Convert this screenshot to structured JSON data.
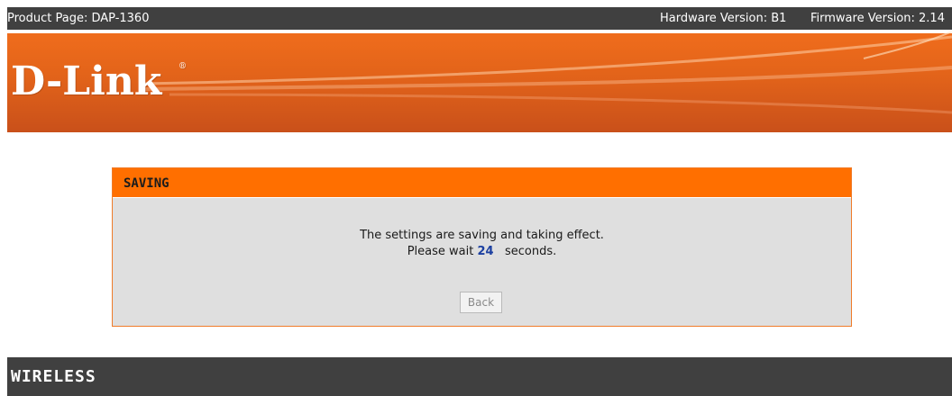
{
  "topbar": {
    "product": "Product Page: DAP-1360",
    "hardware": "Hardware Version: B1",
    "firmware": "Firmware Version: 2.14"
  },
  "brand": {
    "logo_text": "D-Link",
    "registered_mark": "®",
    "banner_color": "#e2631a"
  },
  "saving": {
    "title": "SAVING",
    "line1": "The settings are saving and taking effect.",
    "wait_prefix": "Please wait",
    "seconds_value": "24",
    "wait_suffix": "seconds.",
    "back_label": "Back",
    "header_color": "#ff6f00",
    "count_color": "#1b3fa0"
  },
  "footer": {
    "label": "WIRELESS"
  }
}
